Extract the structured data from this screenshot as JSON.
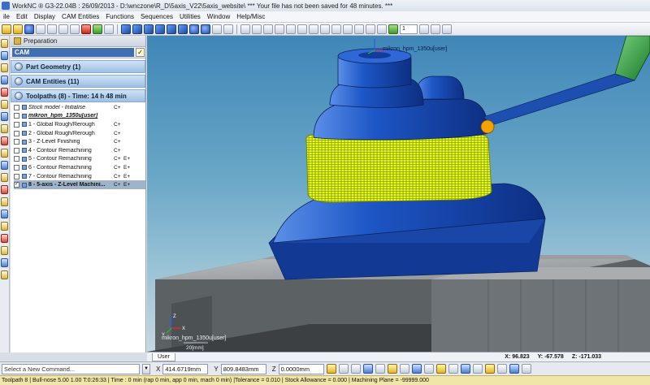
{
  "window": {
    "title": "WorkNC ® G3-22.04B : 26/09/2013 - D:\\wnczone\\R_D\\5axis_V22\\5axis_website\\ *** Your file has not been saved for 48 minutes. ***"
  },
  "menu": [
    "ile",
    "Edit",
    "Display",
    "CAM Entities",
    "Functions",
    "Sequences",
    "Utilities",
    "Window",
    "Help/Misc"
  ],
  "toolbar": {
    "layer_select": "1"
  },
  "panel": {
    "header": "Preparation",
    "cam_label": "CAM",
    "cam_check": "✓",
    "sections": {
      "part_geometry": "Part Geometry (1)",
      "cam_entities": "CAM Entities (11)",
      "toolpaths": "Toolpaths (8) - Time: 14 h 48 min"
    },
    "tree": [
      {
        "label": "Stock model - Initialise",
        "c": "C+",
        "e": "",
        "type": "header",
        "checked": false
      },
      {
        "label": "mikron_hpm_1350u[user]",
        "c": "",
        "e": "",
        "type": "machine",
        "checked": false
      },
      {
        "label": "1 - Global Rough/Rerough",
        "c": "C+",
        "e": "",
        "type": "item",
        "checked": false
      },
      {
        "label": "2 - Global Rough/Rerough",
        "c": "C+",
        "e": "",
        "type": "item",
        "checked": false
      },
      {
        "label": "3 - Z-Level Finishing",
        "c": "C+",
        "e": "",
        "type": "item",
        "checked": false
      },
      {
        "label": "4 - Contour Remachining",
        "c": "C+",
        "e": "",
        "type": "item",
        "checked": false
      },
      {
        "label": "5 - Contour Remachining",
        "c": "C+",
        "e": "E+",
        "type": "item",
        "checked": false
      },
      {
        "label": "6 - Contour Remachining",
        "c": "C+",
        "e": "E+",
        "type": "item",
        "checked": false
      },
      {
        "label": "7 - Contour Remachining",
        "c": "C+",
        "e": "E+",
        "type": "item",
        "checked": false
      },
      {
        "label": "8 - 5-axis - Z-Level Machini...",
        "c": "C+",
        "e": "E+",
        "type": "selected",
        "checked": true
      }
    ]
  },
  "viewport": {
    "tool_label": "mikron_hpm_1350u[user]",
    "corner_label": "mikron_hpm_1350u[user]",
    "scale_label": "20[mm]",
    "axis_x": "X",
    "axis_y": "Y",
    "axis_z": "Z"
  },
  "tabs": {
    "user": "User"
  },
  "cursor_coords": {
    "x": "X:  96.823",
    "y": "Y:  -67.578",
    "z": "Z:  -171.033"
  },
  "command": {
    "placeholder": "Select a New Command...",
    "x_label": "X",
    "x_value": "414.6719mm",
    "y_label": "Y",
    "y_value": "809.8483mm",
    "z_label": "Z",
    "z_value": "0.0000mm"
  },
  "status": "Toolpath 8 | Bull-nose 5.00 1.00 T:0:26:33 | Time : 0 min (rap 0 min, app 0 min, mach 0 min) |Tolerance = 0.010 | Stock Allowance = 0.000 | Machining Plane = -99999.000",
  "colors": {
    "part_blue": "#1a4fb8",
    "toolpath_yellow": "#d8f000",
    "tool_green": "#2e9a3a",
    "selected_row": "#9fb3c9"
  }
}
